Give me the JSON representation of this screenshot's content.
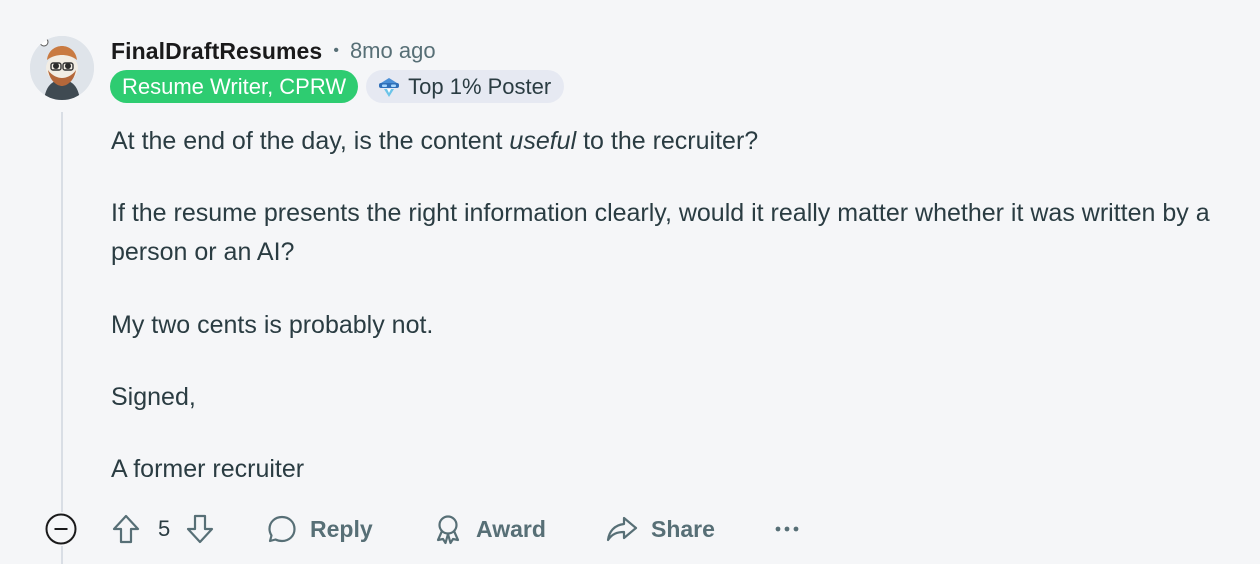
{
  "comment": {
    "username": "FinalDraftResumes",
    "separator": "•",
    "timestamp": "8mo ago",
    "flair_user": "Resume Writer, CPRW",
    "flair_badge": "Top 1% Poster",
    "body": {
      "line1_before": "At the end of the day, is the content ",
      "line1_italic": "useful",
      "line1_after": " to the recruiter?",
      "para2": "If the resume presents the right information clearly, would it really matter whether it was written by a person or an AI?",
      "para3": "My two cents is probably not.",
      "para4": "Signed,",
      "para5": "A former recruiter"
    }
  },
  "actions": {
    "vote_count": "5",
    "reply_label": "Reply",
    "award_label": "Award",
    "share_label": "Share",
    "more_label": "•••"
  },
  "colors": {
    "background": "#f5f6f8",
    "flair_green": "#2ecc71",
    "flair_badge_bg": "#e6e9f2",
    "text": "#2a3c42",
    "muted": "#576f76"
  }
}
